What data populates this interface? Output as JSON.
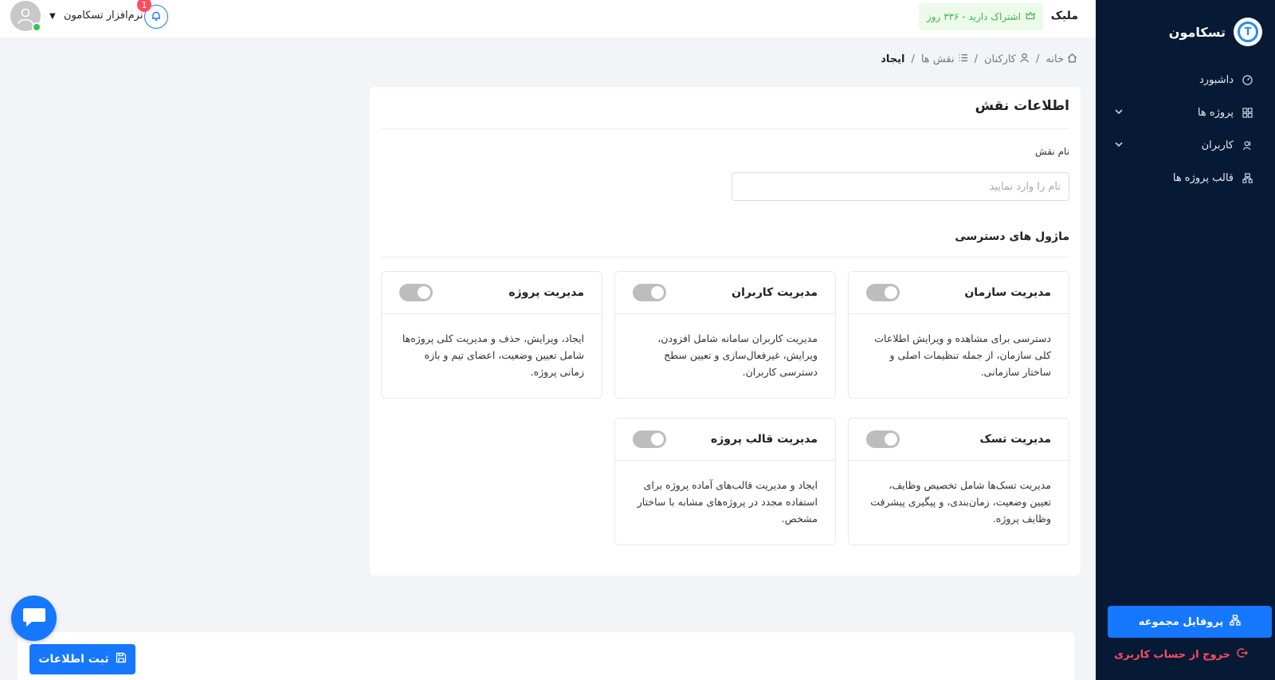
{
  "sidebar": {
    "brand": "تسکامون",
    "brand_letter": "T",
    "items": [
      {
        "label": "داشبورد",
        "icon": "dashboard-icon",
        "has_chevron": false
      },
      {
        "label": "پروژه ها",
        "icon": "grid-icon",
        "has_chevron": true
      },
      {
        "label": "کاربران",
        "icon": "users-icon",
        "has_chevron": true
      },
      {
        "label": "قالب پروژه ها",
        "icon": "template-icon",
        "has_chevron": false
      }
    ],
    "profile_button": "پروفایل مجموعه",
    "logout": "خروج از حساب کاربری"
  },
  "topbar": {
    "company": "ملیک",
    "subscription": "اشتراک دارید - ۳۳۶ روز",
    "user_name": "نرم‌افزار تسکامون",
    "notification_count": "1"
  },
  "breadcrumb": {
    "home": "خانه",
    "employees": "کارکنان",
    "roles": "نقش ها",
    "current": "ایجاد",
    "separator": "/"
  },
  "form": {
    "title": "اطلاعات نقش",
    "name_label": "نام نقش",
    "name_placeholder": "نام را وارد نمایید",
    "name_value": "",
    "modules_title": "ماژول های دسترسی"
  },
  "modules": [
    {
      "title": "مدیریت سازمان",
      "desc": "دسترسی برای مشاهده و ویرایش اطلاعات کلی سازمان، از جمله تنظیمات اصلی و ساختار سازمانی.",
      "enabled": false
    },
    {
      "title": "مدیریت کاربران",
      "desc": "مدیریت کاربران سامانه شامل افزودن، ویرایش، غیرفعال‌سازی و تعیین سطح دسترسی کاربران.",
      "enabled": false
    },
    {
      "title": "مدیریت پروژه",
      "desc": "ایجاد، ویرایش، حذف و مدیریت کلی پروژه‌ها شامل تعیین وضعیت، اعضای تیم و بازه زمانی پروژه.",
      "enabled": false
    },
    {
      "title": "مدیریت تسک",
      "desc": "مدیریت تسک‌ها شامل تخصیص وظایف، تعیین وضعیت، زمان‌بندی، و پیگیری پیشرفت وظایف پروژه.",
      "enabled": false
    },
    {
      "title": "مدیریت قالب پروژه",
      "desc": "ایجاد و مدیریت قالب‌های آماده پروژه برای استفاده مجدد در پروژه‌های مشابه با ساختار مشخص.",
      "enabled": false
    }
  ],
  "actions": {
    "save": "ثبت اطلاعات"
  },
  "colors": {
    "sidebar_bg": "#061a36",
    "primary": "#1677ff",
    "danger": "#ff4d5e",
    "success": "#41b34a",
    "toggle_off": "#bdbdbd"
  }
}
